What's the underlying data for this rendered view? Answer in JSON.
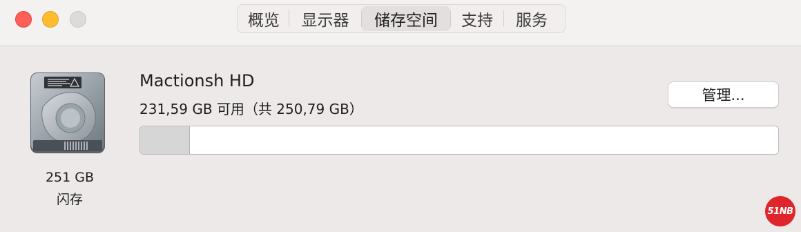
{
  "window": {
    "tabs": [
      {
        "label": "概览"
      },
      {
        "label": "显示器"
      },
      {
        "label": "储存空间",
        "active": true
      },
      {
        "label": "支持"
      },
      {
        "label": "服务"
      }
    ]
  },
  "disk": {
    "name": "Mactionsh HD",
    "available_text": "231,59 GB 可用（共 250,79 GB）",
    "capacity": "251 GB",
    "type": "闪存",
    "used_fraction": 0.0765,
    "icon": "hard-drive-icon"
  },
  "manage_button": {
    "label": "管理..."
  },
  "watermark": {
    "text": "51NB"
  },
  "colors": {
    "close": "#fe5f57",
    "minimize": "#febc2e",
    "maximize": "#dddad9",
    "watermark": "#e0242c"
  }
}
